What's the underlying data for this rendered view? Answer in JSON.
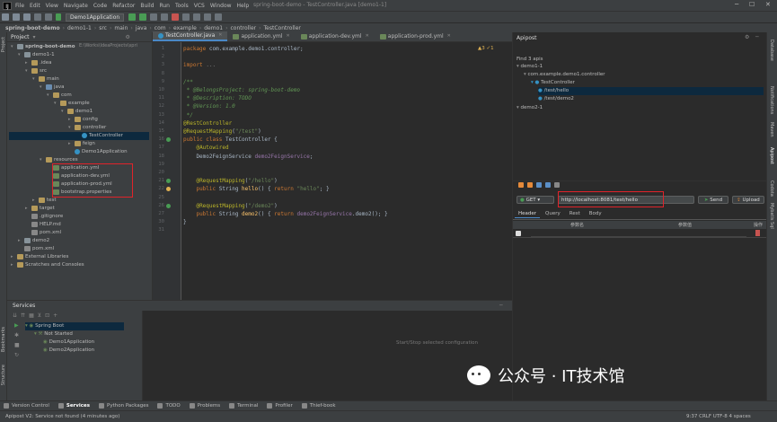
{
  "menubar": {
    "items": [
      "File",
      "Edit",
      "View",
      "Navigate",
      "Code",
      "Refactor",
      "Build",
      "Run",
      "Tools",
      "VCS",
      "Window",
      "Help"
    ],
    "title": "spring-boot-demo - TestController.java [demo1-1]"
  },
  "toolbar": {
    "run_config": "Demo1Application"
  },
  "breadcrumb": [
    "spring-boot-demo",
    "demo1-1",
    "src",
    "main",
    "java",
    "com",
    "example",
    "demo1",
    "controller",
    "TestController"
  ],
  "project": {
    "title": "Project",
    "path": "E:\\Works\\IdeaProjects\\spri",
    "tree": [
      {
        "label": "spring-boot-demo",
        "depth": 0,
        "icon": "mod",
        "open": true
      },
      {
        "label": "demo1-1",
        "depth": 1,
        "icon": "mod",
        "open": true
      },
      {
        "label": ".idea",
        "depth": 2,
        "icon": "folder",
        "open": false
      },
      {
        "label": "src",
        "depth": 2,
        "icon": "folder",
        "open": true
      },
      {
        "label": "main",
        "depth": 3,
        "icon": "folder",
        "open": true
      },
      {
        "label": "java",
        "depth": 4,
        "icon": "sfolder",
        "open": true
      },
      {
        "label": "com",
        "depth": 5,
        "icon": "folder",
        "open": true
      },
      {
        "label": "example",
        "depth": 6,
        "icon": "folder",
        "open": true
      },
      {
        "label": "demo1",
        "depth": 7,
        "icon": "folder",
        "open": true
      },
      {
        "label": "config",
        "depth": 8,
        "icon": "folder",
        "open": false
      },
      {
        "label": "controller",
        "depth": 8,
        "icon": "folder",
        "open": true
      },
      {
        "label": "TestController",
        "depth": 9,
        "icon": "cls",
        "open": null,
        "selected": true
      },
      {
        "label": "feign",
        "depth": 8,
        "icon": "folder",
        "open": false
      },
      {
        "label": "Demo1Application",
        "depth": 8,
        "icon": "cls",
        "open": null
      },
      {
        "label": "resources",
        "depth": 4,
        "icon": "folder",
        "open": true
      },
      {
        "label": "application.yml",
        "depth": 5,
        "icon": "yml",
        "open": null
      },
      {
        "label": "application-dev.yml",
        "depth": 5,
        "icon": "yml",
        "open": null
      },
      {
        "label": "application-prod.yml",
        "depth": 5,
        "icon": "yml",
        "open": null
      },
      {
        "label": "bootstrap.properties",
        "depth": 5,
        "icon": "yml",
        "open": null
      },
      {
        "label": "test",
        "depth": 3,
        "icon": "folder",
        "open": false
      },
      {
        "label": "target",
        "depth": 2,
        "icon": "folder",
        "open": false
      },
      {
        "label": ".gitignore",
        "depth": 2,
        "icon": "file",
        "open": null
      },
      {
        "label": "HELP.md",
        "depth": 2,
        "icon": "file",
        "open": null
      },
      {
        "label": "pom.xml",
        "depth": 2,
        "icon": "file",
        "open": null
      },
      {
        "label": "demo2",
        "depth": 1,
        "icon": "mod",
        "open": false
      },
      {
        "label": "pom.xml",
        "depth": 1,
        "icon": "file",
        "open": null
      },
      {
        "label": "External Libraries",
        "depth": 0,
        "icon": "folder",
        "open": false
      },
      {
        "label": "Scratches and Consoles",
        "depth": 0,
        "icon": "folder",
        "open": false
      }
    ]
  },
  "editor": {
    "tabs": [
      "TestController.java",
      "application.yml",
      "application-dev.yml",
      "application-prod.yml"
    ],
    "inspection": "▲3 ✓1",
    "lines": [
      {
        "n": "1",
        "html": "<span class='kw'>package</span> com.example.demo1.controller;"
      },
      {
        "n": "2",
        "html": ""
      },
      {
        "n": "3",
        "html": "<span class='kw'>import</span> <span class='cmt'>...</span>"
      },
      {
        "n": "8",
        "html": ""
      },
      {
        "n": "9",
        "html": "<span class='cm'>/**</span>"
      },
      {
        "n": "10",
        "html": "<span class='cm'> * @BelongsProject: spring-boot-demo</span>"
      },
      {
        "n": "11",
        "html": "<span class='cm'> * @Description: TODO</span>"
      },
      {
        "n": "12",
        "html": "<span class='cm'> * @Version: 1.0</span>"
      },
      {
        "n": "13",
        "html": "<span class='cm'> */</span>"
      },
      {
        "n": "14",
        "html": "<span class='an'>@RestController</span>"
      },
      {
        "n": "15",
        "html": "<span class='an'>@RequestMapping</span>(<span class='st'>\"/test\"</span>)"
      },
      {
        "n": "16",
        "html": "<span class='kw'>public class</span> TestController {"
      },
      {
        "n": "17",
        "html": "    <span class='an'>@Autowired</span>"
      },
      {
        "n": "18",
        "html": "    Demo2FeignService <span class='fld'>demo2FeignService</span>;"
      },
      {
        "n": "19",
        "html": ""
      },
      {
        "n": "20",
        "html": ""
      },
      {
        "n": "21",
        "html": "    <span class='an'>@RequestMapping</span>(<span class='st'>\"/hello\"</span>)"
      },
      {
        "n": "22",
        "html": "    <span class='kw'>public</span> String <span class='fn'>hello</span>() { <span class='kw'>return</span> <span class='st'>\"hello\"</span>; }"
      },
      {
        "n": "25",
        "html": ""
      },
      {
        "n": "26",
        "html": "    <span class='an'>@RequestMapping</span>(<span class='st'>\"/demo2\"</span>)"
      },
      {
        "n": "27",
        "html": "    <span class='kw'>public</span> String <span class='fn'>demo2</span>() { <span class='kw'>return</span> <span class='fld'>demo2FeignService</span>.demo2(); }"
      },
      {
        "n": "30",
        "html": "}"
      },
      {
        "n": "31",
        "html": ""
      }
    ]
  },
  "apipost": {
    "title": "Apipost",
    "found": "Find 3 apis",
    "tree": [
      {
        "label": "demo1-1",
        "depth": 0
      },
      {
        "label": "com.example.demo1.controller",
        "depth": 1
      },
      {
        "label": "TestController",
        "depth": 2
      },
      {
        "label": "/test/hello",
        "depth": 3,
        "selected": true
      },
      {
        "label": "/test/demo2",
        "depth": 3
      },
      {
        "label": "demo2-1",
        "depth": 0
      }
    ],
    "method": "GET",
    "url": "http://localhost:8081/test/hello",
    "send": "Send",
    "upload": "Upload",
    "subtabs": [
      "Header",
      "Query",
      "Rest",
      "Body"
    ],
    "col1": "参数名",
    "col2": "参数值",
    "col3": "操作"
  },
  "services": {
    "title": "Services",
    "tree": [
      {
        "label": "Spring Boot",
        "depth": 0
      },
      {
        "label": "Not Started",
        "depth": 1
      },
      {
        "label": "Demo1Application",
        "depth": 2
      },
      {
        "label": "Demo2Application",
        "depth": 2
      }
    ],
    "hint": "Start/Stop selected configuration"
  },
  "bottom_tabs": [
    "Version Control",
    "Services",
    "Python Packages",
    "TODO",
    "Problems",
    "Terminal",
    "Profiler",
    "Thief-book"
  ],
  "status": {
    "left": "Apipost V2: Service not found (4 minutes ago)",
    "right": "9:37  CRLF  UTF-8  4 spaces"
  },
  "right_strip": [
    "Database",
    "Notifications",
    "Maven",
    "Apipost",
    "Codota",
    "Mybatis Sql"
  ],
  "left_strip": [
    "Project",
    "Bookmarks",
    "Structure"
  ],
  "watermark": "公众号 · IT技术馆"
}
